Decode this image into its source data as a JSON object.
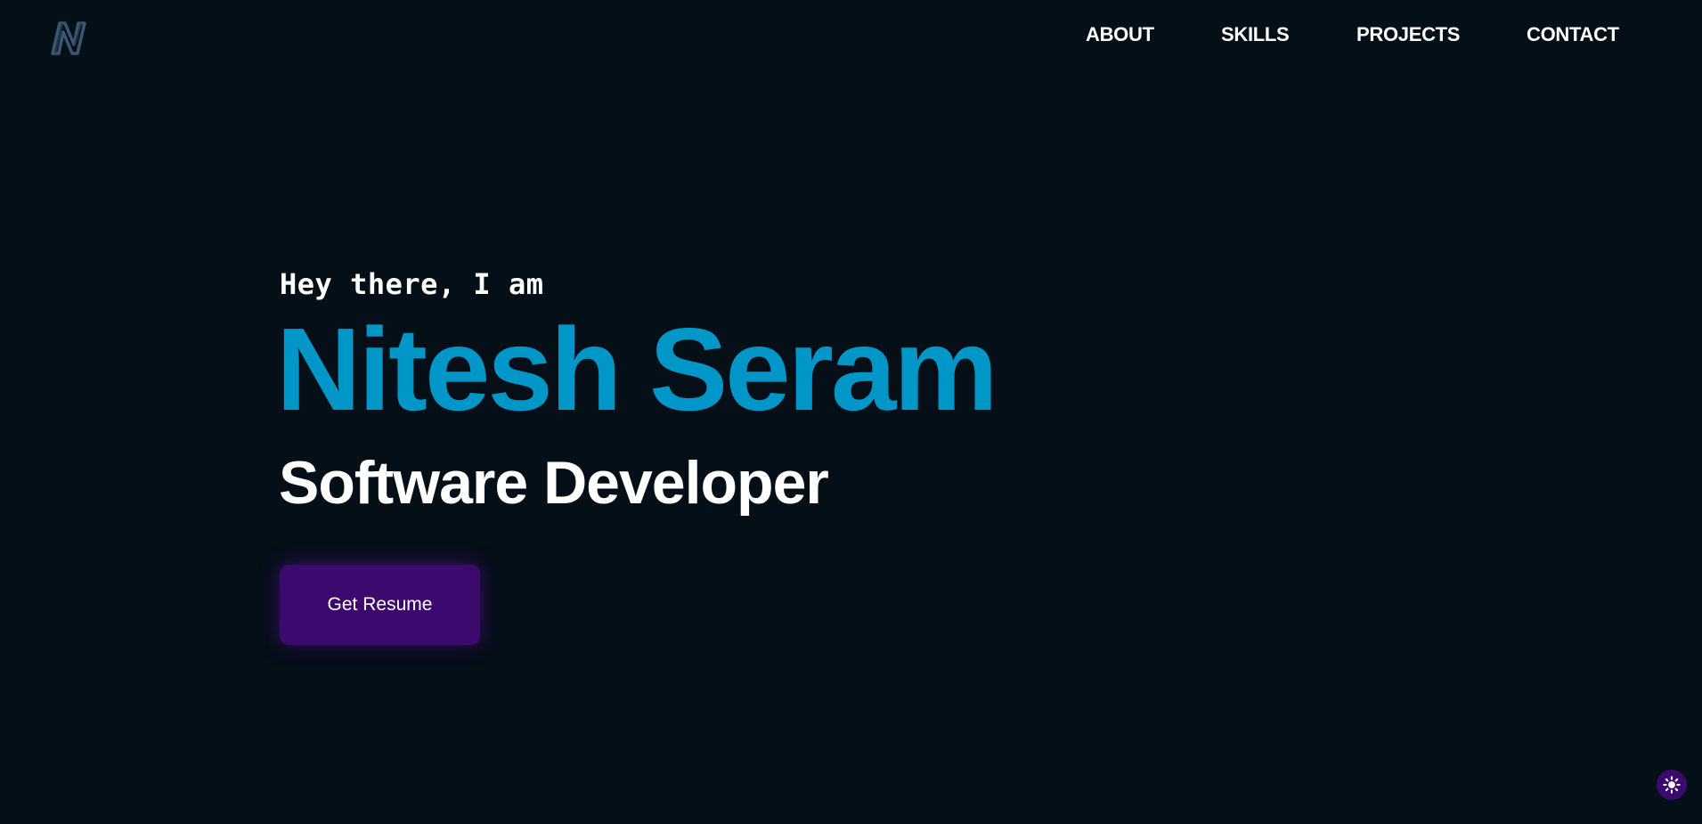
{
  "colors": {
    "background": "#050f18",
    "accent_name": "#0096c7",
    "button": "#3c0a6e",
    "button_glow": "#6a1bb5",
    "toggle": "#3c0a6e",
    "logo_stroke": "#3a5670"
  },
  "header": {
    "logo_icon": "n-monogram-logo-icon",
    "nav": [
      {
        "label": "ABOUT"
      },
      {
        "label": "SKILLS"
      },
      {
        "label": "PROJECTS"
      },
      {
        "label": "CONTACT"
      }
    ]
  },
  "hero": {
    "greeting": "Hey there, I am",
    "name": "Nitesh Seram",
    "role": "Software Developer",
    "resume_label": "Get Resume"
  },
  "theme_toggle": {
    "icon": "sun-icon"
  }
}
